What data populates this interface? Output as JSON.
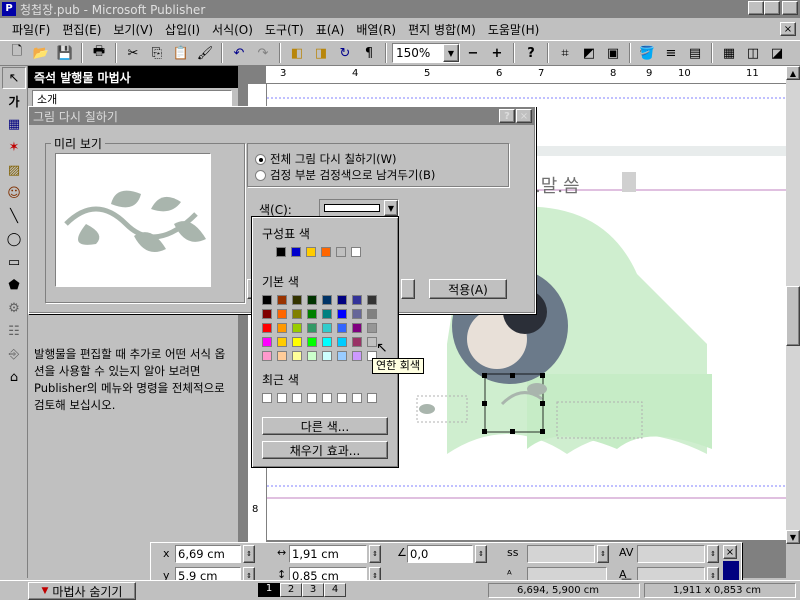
{
  "window": {
    "title": "청첩장.pub - Microsoft Publisher",
    "min_label": "_",
    "max_label": "▫",
    "close_label": "×"
  },
  "menu": [
    "파일(F)",
    "편집(E)",
    "보기(V)",
    "삽입(I)",
    "서식(O)",
    "도구(T)",
    "표(A)",
    "배열(R)",
    "편지 병합(M)",
    "도움말(H)"
  ],
  "toolbar": {
    "zoom": "150%"
  },
  "wizard": {
    "title": "즉석 발행물 마법사",
    "list_item": "소개",
    "description": "발행물을 편집할 때 추가로 어떤 서식 옵션을 사용할 수 있는지 알아 보려면 Publisher의 메뉴와 명령을 전체적으로 검토해 보십시오.",
    "hide_button": "마법사 숨기기"
  },
  "document": {
    "heading_fragment": ".말.씀",
    "ruler_top": [
      "3",
      "4",
      "5",
      "6",
      "7",
      "8",
      "9",
      "10",
      "11"
    ],
    "ruler_left": [
      "4",
      "5",
      "6",
      "7",
      "8"
    ]
  },
  "dialog": {
    "title": "그림 다시 칠하기",
    "help_label": "?",
    "close_label": "×",
    "preview_label": "미리 보기",
    "option_all": "전체 그림 다시 칠하기(W)",
    "option_black": "검정 부분 검정색으로 남겨두기(B)",
    "color_label": "색(C):",
    "apply_button": "적용(A)"
  },
  "colorpicker": {
    "scheme_label": "구성표 색",
    "basic_label": "기본 색",
    "recent_label": "최근 색",
    "more_button": "다른 색...",
    "fill_button": "채우기 효과...",
    "tooltip": "연한 회색",
    "scheme_colors": [
      "#000000",
      "#0000cc",
      "#ffcc00",
      "#ff6600",
      "#c0c0c0",
      "#ffffff"
    ],
    "basic_colors": [
      [
        "#000000",
        "#993300",
        "#333300",
        "#003300",
        "#003366",
        "#000080",
        "#333399",
        "#333333"
      ],
      [
        "#800000",
        "#ff6600",
        "#808000",
        "#008000",
        "#008080",
        "#0000ff",
        "#666699",
        "#808080"
      ],
      [
        "#ff0000",
        "#ff9900",
        "#99cc00",
        "#339966",
        "#33cccc",
        "#3366ff",
        "#800080",
        "#969696"
      ],
      [
        "#ff00ff",
        "#ffcc00",
        "#ffff00",
        "#00ff00",
        "#00ffff",
        "#00ccff",
        "#993366",
        "#c0c0c0"
      ],
      [
        "#ff99cc",
        "#ffcc99",
        "#ffff99",
        "#ccffcc",
        "#ccffff",
        "#99ccff",
        "#cc99ff",
        "#ffffff"
      ]
    ],
    "recent_colors": [
      "#ffffff",
      "#ffffff",
      "#ffffff",
      "#ffffff",
      "#ffffff",
      "#ffffff",
      "#ffffff",
      "#ffffff"
    ]
  },
  "measure": {
    "x_label": "x",
    "y_label": "y",
    "x_value": "6,69 cm",
    "y_value": "5,9 cm",
    "w_value": "1,91 cm",
    "h_value": "0,85 cm",
    "angle_value": "0,0"
  },
  "status": {
    "pages": [
      "1",
      "2",
      "3",
      "4"
    ],
    "position": "6,694, 5,900 cm",
    "size": "1,911 x 0,853 cm"
  },
  "colors": {
    "titlebar_inactive": "#808080",
    "wizard_head": "#000000",
    "page_green": "#cfeecf",
    "leaf_gray": "#a9b5ad"
  }
}
